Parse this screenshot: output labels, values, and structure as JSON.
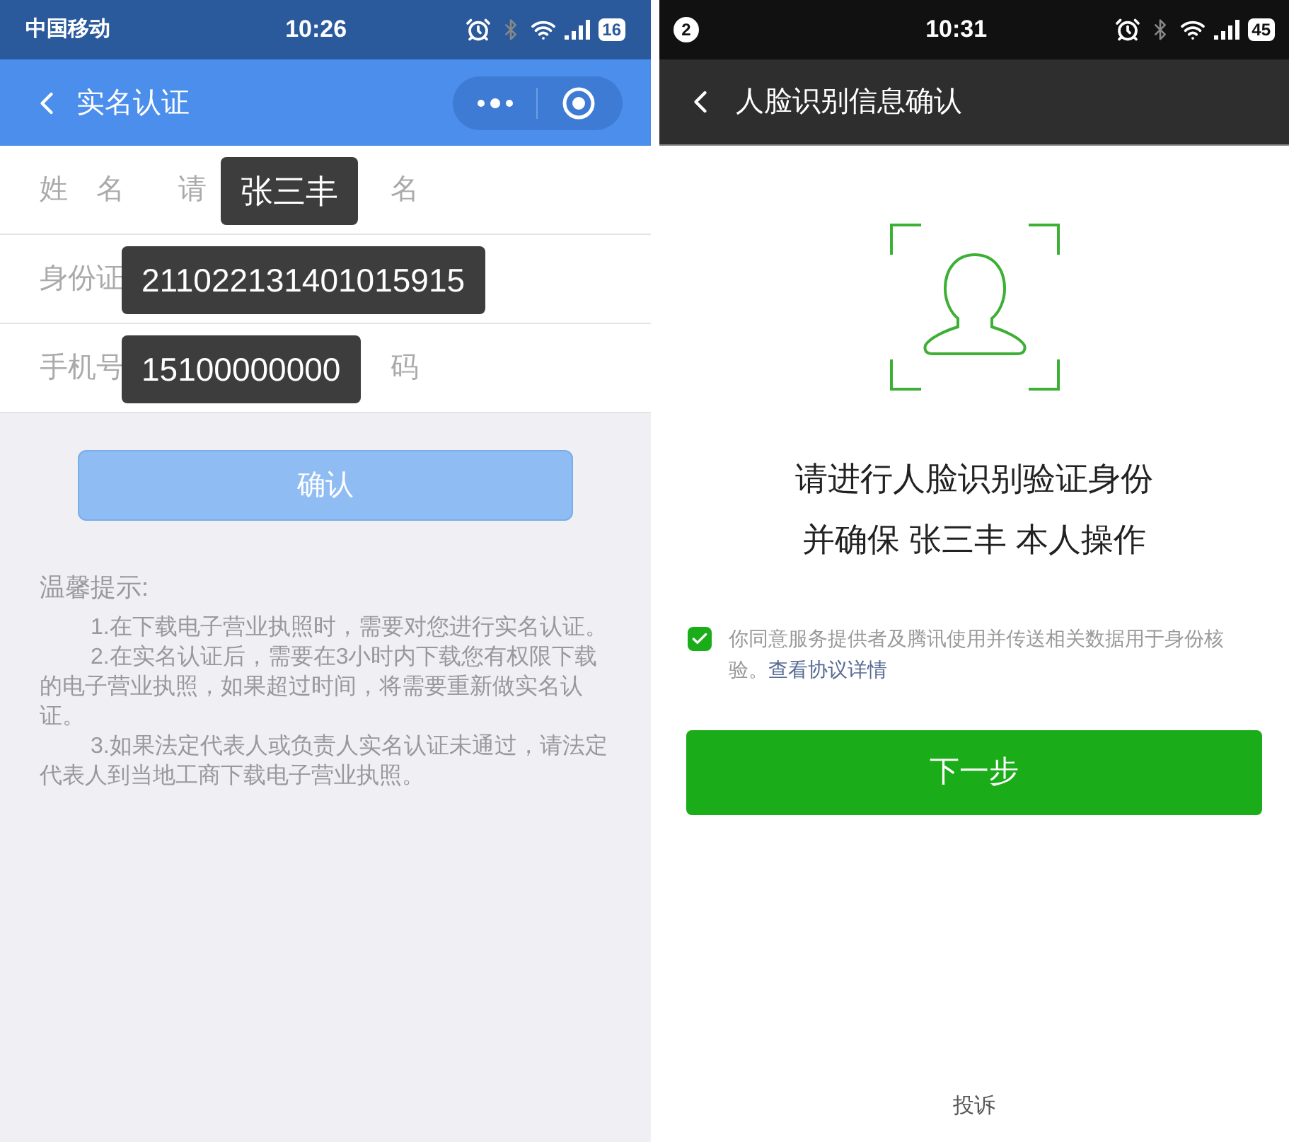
{
  "left_screen": {
    "status_bar": {
      "carrier": "中国移动",
      "time": "10:26",
      "battery": "16"
    },
    "nav": {
      "title": "实名认证"
    },
    "rows": [
      {
        "label": "姓　名",
        "placeholder_before": "请",
        "placeholder_after": "名",
        "value": "张三丰"
      },
      {
        "label": "身份证",
        "placeholder_before": "",
        "placeholder_after": "",
        "value": "211022131401015915"
      },
      {
        "label": "手机号",
        "placeholder_before": "",
        "placeholder_after": "码",
        "value": "15100000000"
      }
    ],
    "confirm_button": {
      "label": "确认",
      "disabled": true
    },
    "tips": {
      "title": "温馨提示:",
      "items": [
        "1.在下载电子营业执照时，需要对您进行实名认证。",
        "2.在实名认证后，需要在3小时内下载您有权限下载的电子营业执照，如果超过时间，将需要重新做实名认证。",
        "3.如果法定代表人或负责人实名认证未通过，请法定代表人到当地工商下载电子营业执照。"
      ]
    }
  },
  "right_screen": {
    "status_bar": {
      "notification_count": "2",
      "time": "10:31",
      "battery": "45"
    },
    "nav": {
      "title": "人脸识别信息确认"
    },
    "prompt": [
      "请进行人脸识别验证身份",
      "并确保 张三丰 本人操作"
    ],
    "agreement": {
      "checked": true,
      "text": "你同意服务提供者及腾讯使用并传送相关数据用于身份核验。",
      "link": "查看协议详情"
    },
    "next_button": {
      "label": "下一步"
    },
    "footer_link": "投诉"
  }
}
